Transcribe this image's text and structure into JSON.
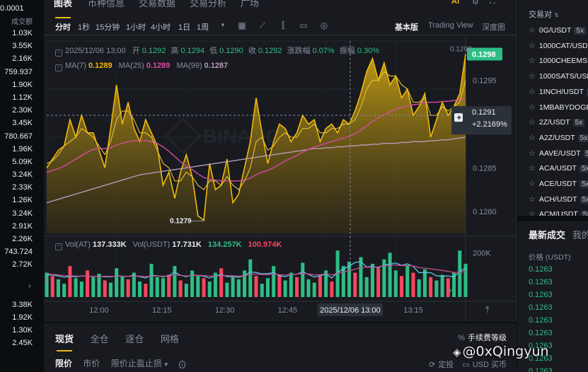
{
  "colors": {
    "up": "#2ebd85",
    "down": "#f6465d",
    "accent": "#f0b90b",
    "bg": "#181a20",
    "ma7": "#f0b90b",
    "ma25": "#d84aa0",
    "ma99": "#b79ab7"
  },
  "left_book": {
    "header": "0.0001",
    "subheader": "成交额",
    "asks": [
      "1.03K",
      "3.55K",
      "2.16K",
      "759.937",
      "1.90K",
      "1.12K",
      "2.30K",
      "3.45K",
      "780.667",
      "1.96K",
      "5.09K",
      "3.24K",
      "2.33K",
      "1.26K",
      "3.24K",
      "2.91K",
      "2.26K",
      "743.724",
      "2.72K"
    ],
    "expand_icon": "chevron-right-icon",
    "bids": [
      "3.38K",
      "1.92K",
      "1.30K",
      "2.45K"
    ]
  },
  "top_tabs": [
    "图表",
    "币种信息",
    "交易数据",
    "交易分析",
    "广场"
  ],
  "toolbar": {
    "timeframes": [
      "分时",
      "1秒",
      "15分钟",
      "1小时",
      "4小时",
      "1日",
      "1周"
    ],
    "active_timeframe": "分时",
    "views": [
      "基本版",
      "Trading View",
      "深度图"
    ],
    "active_view": "基本版"
  },
  "ohlc": {
    "datetime": "2025/12/06 13:00",
    "open_label": "开",
    "open": "0.1292",
    "high_label": "高",
    "high": "0.1294",
    "low_label": "低",
    "low": "0.1290",
    "close_label": "收",
    "close": "0.1292",
    "change_label": "涨跌幅",
    "change": "0.07%",
    "amplitude_label": "振幅",
    "amplitude": "0.30%"
  },
  "ma": {
    "ma7_label": "MA(7)",
    "ma7": "0.1289",
    "ma25_label": "MA(25)",
    "ma25": "0.1289",
    "ma99_label": "MA(99)",
    "ma99": "0.1287"
  },
  "volume": {
    "vol_at_label": "Vol(AT)",
    "vol_at": "137.333K",
    "vol_usdt_label": "Vol(USDT)",
    "vol_usdt": "17.731K",
    "v1": "134.257K",
    "v2": "100.974K",
    "axis_tick": "200K"
  },
  "price_axis": [
    "0.1295",
    "0.1290",
    "0.1285",
    "0.1280"
  ],
  "time_axis": [
    "12:00",
    "12:15",
    "12:30",
    "12:45",
    "13:15"
  ],
  "crosshair_time": "2025/12/06 13:00",
  "last_price": "0.1298",
  "hover_price": {
    "price": "0.1291",
    "change": "+2.2169%"
  },
  "marks": {
    "high": "0.1298",
    "low": "0.1279"
  },
  "watermark_text": "BINANCE",
  "chart_data": {
    "type": "area",
    "x_start": "11:50",
    "x_end": "13:22",
    "x_ticks": [
      "12:00",
      "12:15",
      "12:30",
      "12:45",
      "13:00",
      "13:15"
    ],
    "ylim": [
      0.12775,
      0.12995
    ],
    "price": [
      0.1285,
      0.1286,
      0.1287,
      0.12875,
      0.12905,
      0.12885,
      0.1291,
      0.1289,
      0.1289,
      0.1287,
      0.1285,
      0.12895,
      0.12945,
      0.129,
      0.12925,
      0.12895,
      0.1288,
      0.12905,
      0.1289,
      0.12875,
      0.1283,
      0.12845,
      0.12815,
      0.12845,
      0.12865,
      0.1284,
      0.12795,
      0.1279,
      0.12855,
      0.12825,
      0.1283,
      0.1286,
      0.1281,
      0.1282,
      0.1285,
      0.1288,
      0.1293,
      0.1289,
      0.12855,
      0.1288,
      0.129,
      0.12895,
      0.1288,
      0.1289,
      0.1291,
      0.129,
      0.12905,
      0.1288,
      0.12895,
      0.129,
      0.1289,
      0.12905,
      0.129,
      0.12915,
      0.12935,
      0.1296,
      0.12975,
      0.1295,
      0.1297,
      0.12945,
      0.12955,
      0.1293,
      0.1294,
      0.1291,
      0.1292,
      0.12935,
      0.12885,
      0.12905,
      0.12925,
      0.1291,
      0.1292,
      0.12935,
      0.1298
    ],
    "ma7": [
      0.12855,
      0.12858,
      0.12865,
      0.12875,
      0.1288,
      0.12885,
      0.12895,
      0.1289,
      0.12885,
      0.12875,
      0.12865,
      0.1288,
      0.12905,
      0.12915,
      0.12915,
      0.12905,
      0.1289,
      0.1289,
      0.12885,
      0.1287,
      0.12855,
      0.1285,
      0.12835,
      0.12835,
      0.12845,
      0.1284,
      0.1283,
      0.12825,
      0.12835,
      0.12835,
      0.1283,
      0.1284,
      0.1283,
      0.12825,
      0.12835,
      0.1285,
      0.1288,
      0.12885,
      0.1287,
      0.12875,
      0.12885,
      0.1289,
      0.12885,
      0.12885,
      0.12895,
      0.12895,
      0.129,
      0.1289,
      0.1289,
      0.12895,
      0.12895,
      0.129,
      0.129,
      0.12905,
      0.1292,
      0.1294,
      0.1295,
      0.1295,
      0.1296,
      0.12955,
      0.12955,
      0.12945,
      0.1294,
      0.12925,
      0.12925,
      0.1293,
      0.1291,
      0.1291,
      0.1292,
      0.12915,
      0.1292,
      0.12925,
      0.1295
    ],
    "ma25": [
      0.12845,
      0.12847,
      0.12849,
      0.12852,
      0.12856,
      0.1286,
      0.12864,
      0.12868,
      0.12871,
      0.12872,
      0.12872,
      0.12873,
      0.12876,
      0.12878,
      0.1288,
      0.12881,
      0.12881,
      0.12881,
      0.1288,
      0.12878,
      0.12874,
      0.12869,
      0.12863,
      0.12857,
      0.12852,
      0.12848,
      0.12843,
      0.12839,
      0.12837,
      0.12836,
      0.12835,
      0.12835,
      0.12835,
      0.12835,
      0.12836,
      0.12838,
      0.12842,
      0.12845,
      0.12847,
      0.1285,
      0.12854,
      0.12858,
      0.12861,
      0.12864,
      0.12868,
      0.12871,
      0.12874,
      0.12876,
      0.12878,
      0.1288,
      0.12882,
      0.12884,
      0.12886,
      0.12889,
      0.12893,
      0.12898,
      0.12903,
      0.12907,
      0.12911,
      0.12914,
      0.12917,
      0.12919,
      0.12921,
      0.12922,
      0.12923,
      0.12925,
      0.12925,
      0.12925,
      0.12926,
      0.12926,
      0.12927,
      0.12928,
      0.1293
    ],
    "ma99": [
      0.1281,
      0.12812,
      0.12814,
      0.12816,
      0.12818,
      0.1282,
      0.12822,
      0.12824,
      0.12826,
      0.12828,
      0.1283,
      0.12832,
      0.12834,
      0.12836,
      0.12838,
      0.1284,
      0.12842,
      0.12843,
      0.12844,
      0.12845,
      0.12846,
      0.12847,
      0.12848,
      0.12849,
      0.1285,
      0.12851,
      0.12852,
      0.12853,
      0.12854,
      0.12855,
      0.12856,
      0.12857,
      0.12858,
      0.12859,
      0.1286,
      0.12861,
      0.12862,
      0.12863,
      0.12864,
      0.12865,
      0.12866,
      0.12867,
      0.12868,
      0.12869,
      0.1287,
      0.12871,
      0.12872,
      0.12872,
      0.12873,
      0.12873,
      0.12874,
      0.12874,
      0.12875,
      0.12875,
      0.12876,
      0.12876,
      0.12877,
      0.12877,
      0.12878,
      0.12878,
      0.12878,
      0.12879,
      0.12879,
      0.1288,
      0.1288,
      0.1288,
      0.12881,
      0.12881,
      0.12882,
      0.12882,
      0.12883,
      0.12884,
      0.12885
    ],
    "volume": {
      "values": [
        110,
        95,
        80,
        60,
        140,
        85,
        70,
        120,
        90,
        105,
        75,
        65,
        130,
        95,
        80,
        110,
        70,
        60,
        150,
        90,
        85,
        100,
        140,
        75,
        60,
        120,
        95,
        85,
        70,
        110,
        130,
        65,
        90,
        80,
        120,
        170,
        95,
        60,
        85,
        140,
        100,
        75,
        110,
        90,
        155,
        80,
        65,
        95,
        120,
        70,
        210,
        140,
        160,
        110,
        180,
        90,
        150,
        130,
        170,
        200,
        120,
        95,
        145,
        110,
        80,
        125,
        90,
        75,
        100,
        85,
        110,
        210,
        150
      ],
      "up": [
        true,
        false,
        true,
        true,
        false,
        true,
        true,
        false,
        true,
        true,
        false,
        true,
        true,
        true,
        false,
        true,
        true,
        false,
        true,
        true,
        true,
        false,
        true,
        false,
        true,
        true,
        true,
        false,
        true,
        true,
        false,
        true,
        true,
        true,
        true,
        true,
        false,
        true,
        true,
        true,
        false,
        true,
        true,
        false,
        true,
        true,
        true,
        false,
        true,
        false,
        true,
        true,
        true,
        false,
        true,
        true,
        true,
        false,
        true,
        true,
        true,
        false,
        true,
        false,
        true,
        true,
        false,
        true,
        true,
        false,
        true,
        true,
        true
      ],
      "ylim": [
        0,
        230
      ],
      "ma5": [
        100,
        100,
        95,
        90,
        93,
        92,
        95,
        95,
        93,
        94,
        92,
        91,
        96,
        94,
        93,
        98,
        92,
        86,
        98,
        96,
        91,
        97,
        113,
        98,
        92,
        99,
        98,
        94,
        86,
        96,
        101,
        92,
        93,
        89,
        97,
        113,
        111,
        105,
        106,
        110,
        96,
        92,
        102,
        103,
        114,
        102,
        90,
        97,
        103,
        86,
        112,
        127,
        140,
        156,
        160,
        136,
        138,
        132,
        144,
        148,
        154,
        143,
        150,
        138,
        110,
        111,
        110,
        96,
        94,
        95,
        90,
        116,
        131
      ],
      "ma10": [
        105,
        102,
        100,
        97,
        96,
        95,
        94,
        94,
        93,
        93,
        94,
        93,
        94,
        94,
        93,
        94,
        94,
        92,
        95,
        95,
        94,
        94,
        100,
        98,
        95,
        97,
        98,
        97,
        95,
        95,
        96,
        97,
        96,
        94,
        96,
        102,
        104,
        102,
        101,
        104,
        101,
        99,
        101,
        103,
        108,
        104,
        100,
        101,
        105,
        100,
        107,
        113,
        118,
        126,
        133,
        135,
        134,
        136,
        141,
        143,
        145,
        142,
        143,
        140,
        133,
        130,
        127,
        124,
        120,
        116,
        111,
        112,
        116
      ]
    }
  },
  "right_col": {
    "pairs_header": "交易对",
    "pairs": [
      {
        "name": "0G/USDT",
        "lev": "5x"
      },
      {
        "name": "1000CAT/USDT",
        "lev": ""
      },
      {
        "name": "1000CHEEMS",
        "lev": ""
      },
      {
        "name": "1000SATS/USDT",
        "lev": ""
      },
      {
        "name": "1INCH/USDT",
        "lev": "5x"
      },
      {
        "name": "1MBABYDOGE",
        "lev": ""
      },
      {
        "name": "2Z/USDT",
        "lev": "5x"
      },
      {
        "name": "A2Z/USDT",
        "lev": "5x"
      },
      {
        "name": "AAVE/USDT",
        "lev": "5x"
      },
      {
        "name": "ACA/USDT",
        "lev": "5x"
      },
      {
        "name": "ACE/USDT",
        "lev": "5x"
      },
      {
        "name": "ACH/USDT",
        "lev": "5x"
      },
      {
        "name": "ACM/USDT",
        "lev": "5x"
      }
    ],
    "trades_tab_active": "最新成交",
    "trades_tab_other": "我的",
    "trades_col_price": "价格 (USDT)",
    "trades": [
      "0.1263",
      "0.1263",
      "0.1263",
      "0.1263",
      "0.1263",
      "0.1263",
      "0.1263",
      "0.1263",
      "0.1263"
    ]
  },
  "bottom": {
    "pos_tabs": [
      "现货",
      "全仓",
      "逐仓",
      "网格"
    ],
    "fee_level": "手续费等级",
    "order_tabs": [
      "限价",
      "市价",
      "限价止盈止损"
    ],
    "right_items": [
      "定投",
      "USD 买币"
    ]
  },
  "watermark_overlay": "@0xQingyun"
}
